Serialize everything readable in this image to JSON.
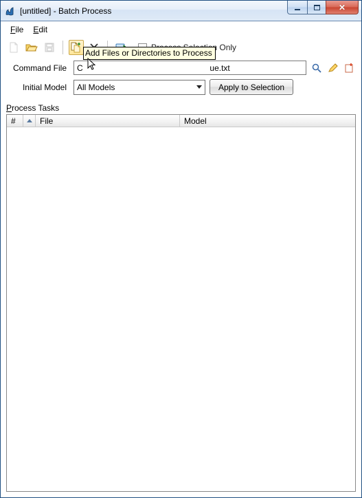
{
  "window": {
    "title": "[untitled] - Batch Process"
  },
  "menu": {
    "file": "File",
    "edit": "Edit"
  },
  "toolbar": {
    "checkbox_label": "Process Selection Only",
    "tooltip": "Add Files or Directories to Process"
  },
  "form": {
    "command_file_label": "Command File",
    "command_file_prefix": "C",
    "command_file_suffix": "ue.txt",
    "initial_model_label": "Initial Model",
    "initial_model_value": "All Models",
    "apply_button": "Apply to Selection"
  },
  "section": {
    "process_tasks_label": "Process Tasks"
  },
  "table": {
    "col_num": "#",
    "col_file": "File",
    "col_model": "Model"
  },
  "icons": {
    "app": "app-icon",
    "new": "new-file-icon",
    "open": "open-folder-icon",
    "save": "save-icon",
    "addfiles": "add-files-icon",
    "delete": "delete-icon",
    "process": "process-icon",
    "magnify": "magnify-icon",
    "pencil": "pencil-icon",
    "newcmd": "new-command-icon"
  }
}
